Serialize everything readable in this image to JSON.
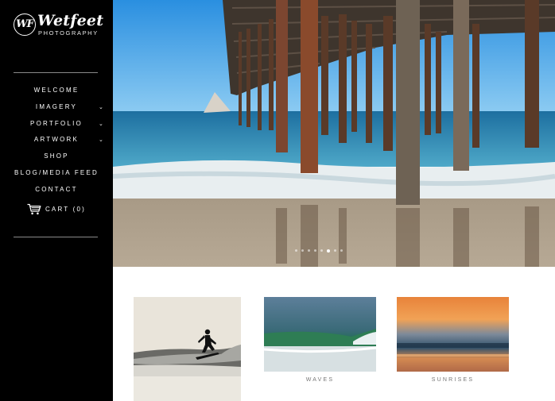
{
  "brand": {
    "mark": "WF",
    "name": "Wetfeet",
    "subtitle": "PHOTOGRAPHY"
  },
  "nav": {
    "items": [
      {
        "label": "WELCOME",
        "has_submenu": false
      },
      {
        "label": "IMAGERY",
        "has_submenu": true
      },
      {
        "label": "PORTFOLIO",
        "has_submenu": true
      },
      {
        "label": "ARTWORK",
        "has_submenu": true
      },
      {
        "label": "SHOP",
        "has_submenu": false
      },
      {
        "label": "BLOG/MEDIA FEED",
        "has_submenu": false
      },
      {
        "label": "CONTACT",
        "has_submenu": false
      }
    ],
    "cart_label": "CART (0)",
    "chevron_icon": "chevron-down-icon",
    "cart_icon": "shopping-cart-icon"
  },
  "hero": {
    "subject": "pier-at-beach",
    "slide_count": 8,
    "active_slide": 6
  },
  "gallery": {
    "items": [
      {
        "label": "",
        "subject": "surfer-silhouette"
      },
      {
        "label": "WAVES",
        "subject": "green-wave"
      },
      {
        "label": "SUNRISES",
        "subject": "orange-sunrise-over-sea"
      }
    ]
  },
  "colors": {
    "sidebar_bg": "#000000",
    "nav_text": "#ffffff",
    "label_text": "#777777"
  }
}
